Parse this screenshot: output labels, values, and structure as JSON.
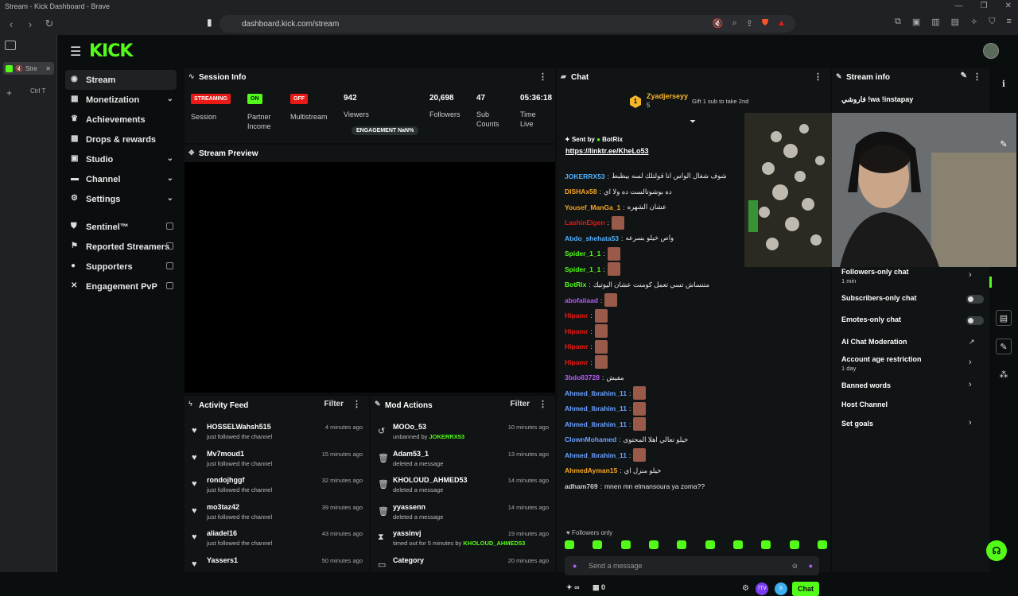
{
  "browser": {
    "window_title": "Stream - Kick Dashboard - Brave",
    "url": "dashboard.kick.com/stream",
    "tab_label": "Stre",
    "newtab_shortcut": "Ctrl T"
  },
  "app": {
    "logo": "KICK"
  },
  "sidebar": {
    "items": [
      {
        "label": "Stream",
        "icon": "dashboard-icon"
      },
      {
        "label": "Monetization",
        "icon": "dollar-icon"
      },
      {
        "label": "Achievements",
        "icon": "trophy-icon"
      },
      {
        "label": "Drops & rewards",
        "icon": "gift-icon"
      },
      {
        "label": "Studio",
        "icon": "studio-icon"
      },
      {
        "label": "Channel",
        "icon": "channel-icon"
      },
      {
        "label": "Settings",
        "icon": "gear-icon"
      }
    ],
    "external_items": [
      {
        "label": "Sentinel™",
        "icon": "shield-icon"
      },
      {
        "label": "Reported Streamers",
        "icon": "flag-icon"
      },
      {
        "label": "Supporters",
        "icon": "person-icon"
      },
      {
        "label": "Engagement PvP",
        "icon": "swords-icon"
      }
    ]
  },
  "session": {
    "title": "Session Info",
    "status_badge": "STREAMING",
    "status_label": "Session",
    "partner_badge": "ON",
    "partner_label": "Partner Income",
    "multistream_badge": "OFF",
    "multistream_label": "Multistream",
    "viewers": "942",
    "viewers_label": "Viewers",
    "engagement": "ENGAGEMENT NaN%",
    "followers": "20,698",
    "followers_label": "Followers",
    "subs": "47",
    "subs_label": "Sub Counts",
    "time_live": "05:36:18",
    "time_live_label": "Time Live"
  },
  "preview": {
    "title": "Stream Preview"
  },
  "activity": {
    "title": "Activity Feed",
    "filter": "Filter",
    "items": [
      {
        "name": "HOSSELWahsh515",
        "sub": "just followed the channel",
        "time": "4 minutes ago"
      },
      {
        "name": "Mv7moud1",
        "sub": "just followed the channel",
        "time": "15 minutes ago"
      },
      {
        "name": "rondojhggf",
        "sub": "just followed the channel",
        "time": "32 minutes ago"
      },
      {
        "name": "mo3taz42",
        "sub": "just followed the channel",
        "time": "39 minutes ago"
      },
      {
        "name": "aliadel16",
        "sub": "just followed the channel",
        "time": "43 minutes ago"
      },
      {
        "name": "Yassers1",
        "sub": "",
        "time": "50 minutes ago"
      }
    ]
  },
  "mod": {
    "title": "Mod Actions",
    "filter": "Filter",
    "items": [
      {
        "name": "MOOo_53",
        "sub": "unbanned by ",
        "by": "JOKERRX53",
        "time": "10 minutes ago",
        "icon": "undo-icon"
      },
      {
        "name": "Adam53_1",
        "sub": "deleted a message",
        "by": "",
        "time": "13 minutes ago",
        "icon": "trash-icon"
      },
      {
        "name": "KHOLOUD_AHMED53",
        "sub": "deleted a message",
        "by": "",
        "time": "14 minutes ago",
        "icon": "trash-icon"
      },
      {
        "name": "yyassenn",
        "sub": "deleted a message",
        "by": "",
        "time": "14 minutes ago",
        "icon": "trash-icon"
      },
      {
        "name": "yassinvj",
        "sub": "timed out for 5 minutes by ",
        "by": "KHOLOUD_AHMED53",
        "time": "19 minutes ago",
        "icon": "hourglass-icon"
      },
      {
        "name": "Category",
        "sub": "",
        "by": "",
        "time": "20 minutes ago",
        "icon": "category-icon"
      }
    ]
  },
  "chat": {
    "title": "Chat",
    "gifter_rank": "1",
    "gifter_name": "Zyadjerseyy",
    "gifter_count": "5",
    "gift_cta": "Gift 1 sub to take 2nd",
    "pinned_header": "Sent by",
    "pinned_user": "BotRix",
    "pinned_link": "https://linktr.ee/KheLo53",
    "messages": [
      {
        "user": "JOKERRX53",
        "color": "#53b0fc",
        "text": "شوف شغال الواس انا قولتلك لسه بيظبط",
        "emote": false
      },
      {
        "user": "DISHAx58",
        "color": "#f5a623",
        "text": "ده بوشوتالست ده ولا اي",
        "emote": false
      },
      {
        "user": "Yousef_ManGa_1",
        "color": "#f5a623",
        "text": "عشان الشهره",
        "emote": false
      },
      {
        "user": "LashinElgen",
        "color": "#e91916",
        "text": "",
        "emote": true
      },
      {
        "user": "Abdo_shehata53",
        "color": "#53b0fc",
        "text": "واص خيلو بسرعه",
        "emote": false
      },
      {
        "user": "Spider_1_1",
        "color": "#53fc18",
        "text": "",
        "emote": true
      },
      {
        "user": "Spider_1_1",
        "color": "#53fc18",
        "text": "",
        "emote": true
      },
      {
        "user": "BotRix",
        "color": "#53fc18",
        "text": "متنساش تسي تعمل كومنت عشان اليوتيك",
        "emote": false
      },
      {
        "user": "abofaiiaad",
        "color": "#b45cf5",
        "text": "",
        "emote": true
      },
      {
        "user": "Hipamr",
        "color": "#e91916",
        "text": "",
        "emote": true
      },
      {
        "user": "Hipamr",
        "color": "#e91916",
        "text": "",
        "emote": true
      },
      {
        "user": "Hipamr",
        "color": "#e91916",
        "text": "",
        "emote": true
      },
      {
        "user": "Hipamr",
        "color": "#e91916",
        "text": "",
        "emote": true
      },
      {
        "user": "3bdo83728",
        "color": "#b45cf5",
        "text": "مفيش",
        "emote": false
      },
      {
        "user": "Ahmed_Ibrahim_11",
        "color": "#6aa0ff",
        "text": "",
        "emote": true
      },
      {
        "user": "Ahmed_Ibrahim_11",
        "color": "#6aa0ff",
        "text": "",
        "emote": true
      },
      {
        "user": "Ahmed_Ibrahim_11",
        "color": "#6aa0ff",
        "text": "",
        "emote": true
      },
      {
        "user": "ClownMohamed",
        "color": "#6aa0ff",
        "text": "خيلو تعالي اهلا المحتوى",
        "emote": false
      },
      {
        "user": "Ahmed_Ibrahim_11",
        "color": "#6aa0ff",
        "text": "",
        "emote": true
      },
      {
        "user": "AhmedAyman15",
        "color": "#f5a623",
        "text": "خيلو منزل اي",
        "emote": false
      },
      {
        "user": "adham769",
        "color": "#cfcfcf",
        "text": "mnen mn elmansoura ya zoma??",
        "emote": false
      }
    ],
    "followers_only": "Followers only",
    "input_placeholder": "Send a message",
    "infinity_count": "∞",
    "gift_count": "0",
    "send_label": "Chat"
  },
  "stream_info": {
    "title": "Stream info",
    "stream_title": "فاروشي !wa !instapay",
    "settings": [
      {
        "label": "Followers-only chat",
        "sub": "1 min",
        "control": "chevron"
      },
      {
        "label": "Subscribers-only chat",
        "sub": "",
        "control": "toggle"
      },
      {
        "label": "Emotes-only chat",
        "sub": "",
        "control": "toggle"
      },
      {
        "label": "AI Chat Moderation",
        "sub": "",
        "control": "external"
      },
      {
        "label": "Account age restriction",
        "sub": "1 day",
        "control": "chevron"
      },
      {
        "label": "Banned words",
        "sub": "",
        "control": "chevron"
      },
      {
        "label": "Host Channel",
        "sub": "",
        "control": "none"
      },
      {
        "label": "Set goals",
        "sub": "",
        "control": "chevron"
      }
    ]
  },
  "colors": {
    "accent": "#53fc18",
    "danger": "#e91916",
    "panel": "#111415",
    "bg": "#0b0e0f"
  }
}
